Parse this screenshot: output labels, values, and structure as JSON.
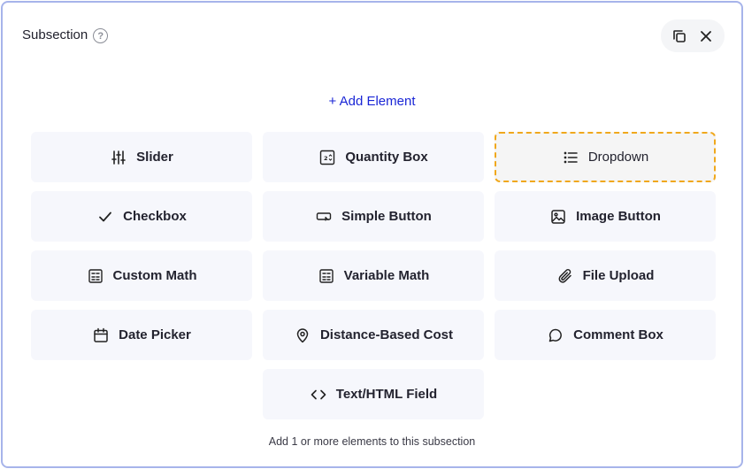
{
  "panel": {
    "title": "Subsection",
    "help_glyph": "?"
  },
  "actions": {
    "duplicate_icon": "copy-icon",
    "close_icon": "close-icon"
  },
  "add_element_label": "+ Add Element",
  "elements": [
    {
      "label": "Slider",
      "icon": "sliders-icon"
    },
    {
      "label": "Quantity Box",
      "icon": "quantity-icon"
    },
    {
      "label": "Dropdown",
      "icon": "list-icon",
      "selected": true
    },
    {
      "label": "Checkbox",
      "icon": "check-icon"
    },
    {
      "label": "Simple Button",
      "icon": "button-icon"
    },
    {
      "label": "Image Button",
      "icon": "image-icon"
    },
    {
      "label": "Custom Math",
      "icon": "calculator-icon"
    },
    {
      "label": "Variable Math",
      "icon": "calculator-icon"
    },
    {
      "label": "File Upload",
      "icon": "paperclip-icon"
    },
    {
      "label": "Date Picker",
      "icon": "calendar-icon"
    },
    {
      "label": "Distance-Based Cost",
      "icon": "map-pin-icon"
    },
    {
      "label": "Comment Box",
      "icon": "comment-icon"
    },
    {
      "label": "Text/HTML Field",
      "icon": "code-icon"
    }
  ],
  "footer_note": "Add 1 or more elements to this subsection",
  "colors": {
    "accent_link": "#1a26d6",
    "selected_border": "#f0a81c",
    "tile_bg": "#f6f7fc",
    "frame_border": "#a7b4ea"
  }
}
